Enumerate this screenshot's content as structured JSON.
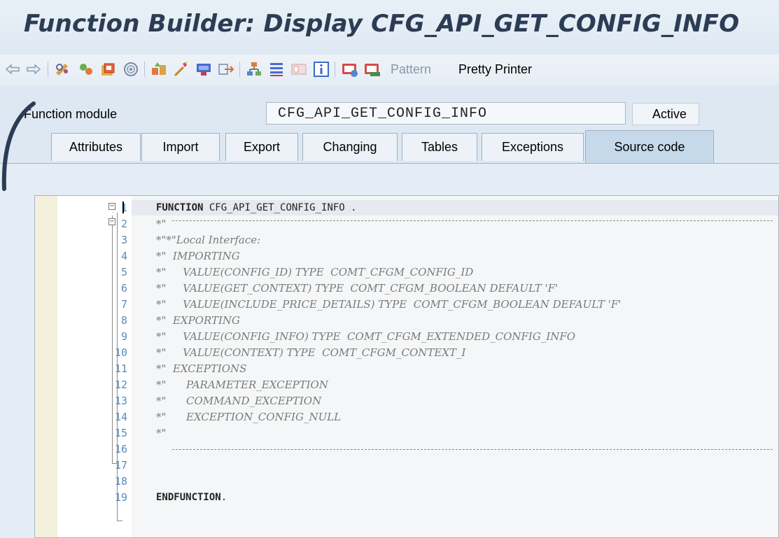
{
  "window": {
    "title": "Function Builder: Display CFG_API_GET_CONFIG_INFO"
  },
  "toolbar": {
    "icons": [
      "back-arrow-icon",
      "forward-arrow-icon",
      "edit-glasses-icon",
      "display-change-icon",
      "other-object-icon",
      "where-used-icon",
      "activate-icon",
      "check-icon",
      "test-icon",
      "navigate-icon",
      "hierarchy-icon",
      "list-icon",
      "panel-icon",
      "info-icon",
      "display-object-icon",
      "stop-test-icon"
    ],
    "pattern_label": "Pattern",
    "pretty_printer_label": "Pretty Printer",
    "pattern_color": "#8a97a8"
  },
  "header": {
    "function_module_label": "Function module",
    "function_module_value": "CFG_API_GET_CONFIG_INFO",
    "status": "Active"
  },
  "tabs": [
    {
      "label": "Attributes"
    },
    {
      "label": "Import"
    },
    {
      "label": "Export"
    },
    {
      "label": "Changing"
    },
    {
      "label": "Tables"
    },
    {
      "label": "Exceptions"
    },
    {
      "label": "Source code",
      "active": true
    }
  ],
  "source": {
    "lines": [
      {
        "no": "1",
        "text": "FUNCTION CFG_API_GET_CONFIG_INFO ."
      },
      {
        "no": "2",
        "text": "*\""
      },
      {
        "no": "3",
        "text": "*\"*\"Local Interface:"
      },
      {
        "no": "4",
        "text": "*\"  IMPORTING"
      },
      {
        "no": "5",
        "text": "*\"     VALUE(CONFIG_ID) TYPE  COMT_CFGM_CONFIG_ID"
      },
      {
        "no": "6",
        "text": "*\"     VALUE(GET_CONTEXT) TYPE  COMT_CFGM_BOOLEAN DEFAULT 'F'"
      },
      {
        "no": "7",
        "text": "*\"     VALUE(INCLUDE_PRICE_DETAILS) TYPE  COMT_CFGM_BOOLEAN DEFAULT 'F'"
      },
      {
        "no": "8",
        "text": "*\"  EXPORTING"
      },
      {
        "no": "9",
        "text": "*\"     VALUE(CONFIG_INFO) TYPE  COMT_CFGM_EXTENDED_CONFIG_INFO"
      },
      {
        "no": "10",
        "text": "*\"     VALUE(CONTEXT) TYPE  COMT_CFGM_CONTEXT_I"
      },
      {
        "no": "11",
        "text": "*\"  EXCEPTIONS"
      },
      {
        "no": "12",
        "text": "*\"      PARAMETER_EXCEPTION"
      },
      {
        "no": "13",
        "text": "*\"      COMMAND_EXCEPTION"
      },
      {
        "no": "14",
        "text": "*\"      EXCEPTION_CONFIG_NULL"
      },
      {
        "no": "15",
        "text": "*\""
      },
      {
        "no": "16",
        "text": ""
      },
      {
        "no": "17",
        "text": ""
      },
      {
        "no": "18",
        "text": ""
      },
      {
        "no": "19",
        "text": "ENDFUNCTION."
      }
    ]
  },
  "colors": {
    "title": "#2b3c54",
    "line_numbers": "#5a8ab8",
    "comment": "#7a7a7a",
    "active_tab": "#c5d9ea"
  }
}
